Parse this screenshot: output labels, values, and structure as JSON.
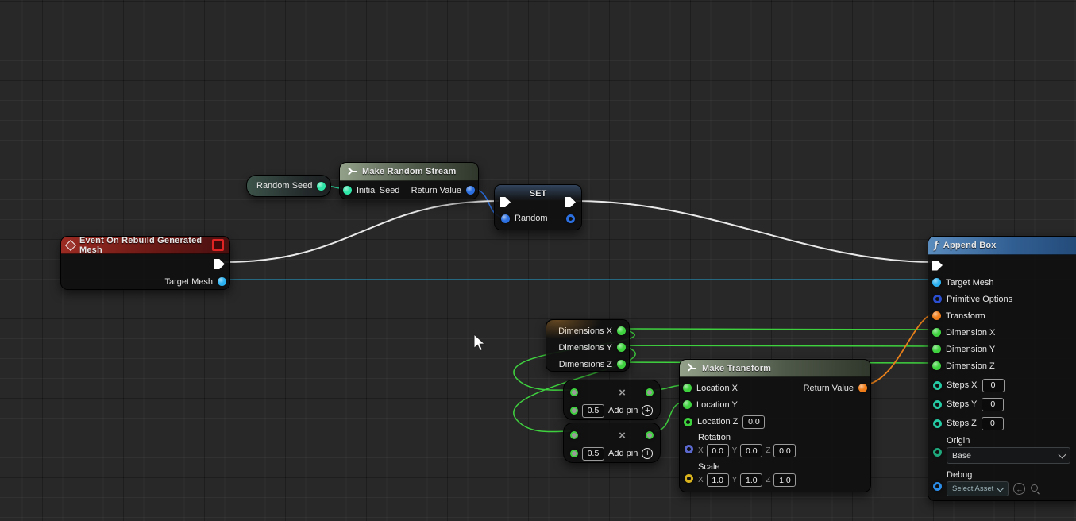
{
  "colors": {
    "background": "#282828",
    "exec_pin": "#ffffff",
    "int_pin": "#2ee6a8",
    "float_pin": "#3fd23f",
    "object_pin_light": "#2bb1f0",
    "randomstream_pin": "#2b6fe0",
    "primitive_options_pin": "#2b4fd0",
    "transform_pin": "#ef7d1a",
    "steps_pin": "#25c9a3",
    "rotator_pin": "#5b68ce",
    "scale_pin": "#d8b31e",
    "origin_pin": "#1fa87c",
    "debug_pin": "#2b8de8",
    "event_header": "#9b2b23",
    "function_header": "#5b8cbe",
    "pure_header": "#93a18a",
    "wire_exec": "#e8e8e8",
    "wire_green": "#3fd23f",
    "wire_orange": "#e8801a",
    "wire_teal_line": "#1f89b0"
  },
  "axes": {
    "x": "X",
    "y": "Y",
    "z": "Z"
  },
  "nodes": {
    "random_seed": {
      "title": "Random Seed"
    },
    "make_random_stream": {
      "title": "Make Random Stream",
      "initial_seed": "Initial Seed",
      "return_value": "Return Value"
    },
    "set_node": {
      "title": "SET",
      "variable": "Random"
    },
    "event_node": {
      "title": "Event On Rebuild Generated Mesh",
      "target_mesh": "Target Mesh"
    },
    "dimensions_node": {
      "pin_x": "Dimensions X",
      "pin_y": "Dimensions Y",
      "pin_z": "Dimensions Z"
    },
    "multiply_1": {
      "operator": "×",
      "value": "0.5",
      "add_pin": "Add pin",
      "plus": "+"
    },
    "multiply_2": {
      "operator": "×",
      "value": "0.5",
      "add_pin": "Add pin",
      "plus": "+"
    },
    "make_transform": {
      "title": "Make Transform",
      "location_x": "Location X",
      "location_y": "Location Y",
      "location_z": "Location Z",
      "location_z_value": "0.0",
      "return_value": "Return Value",
      "rotation_label": "Rotation",
      "rotation": {
        "x": "0.0",
        "y": "0.0",
        "z": "0.0"
      },
      "scale_label": "Scale",
      "scale": {
        "x": "1.0",
        "y": "1.0",
        "z": "1.0"
      }
    },
    "append_box": {
      "title": "Append Box",
      "fn_icon": "f",
      "target_mesh": "Target Mesh",
      "primitive_options": "Primitive Options",
      "transform": "Transform",
      "dimension_x": "Dimension X",
      "dimension_y": "Dimension Y",
      "dimension_z": "Dimension Z",
      "steps_x": "Steps X",
      "steps_x_value": "0",
      "steps_y": "Steps Y",
      "steps_y_value": "0",
      "steps_z": "Steps Z",
      "steps_z_value": "0",
      "origin_label": "Origin",
      "origin_value": "Base",
      "debug_label": "Debug",
      "debug_value": "Select Asset"
    }
  }
}
